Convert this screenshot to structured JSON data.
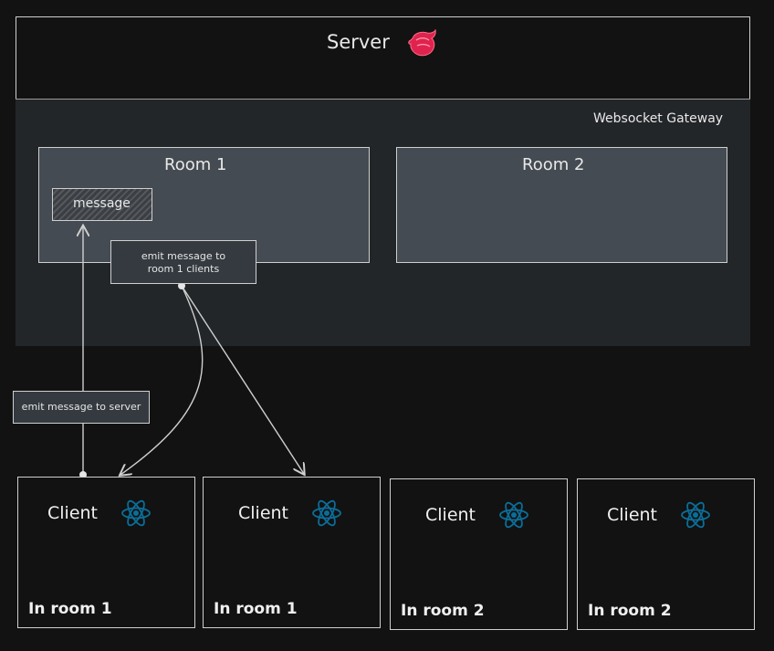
{
  "server": {
    "title": "Server",
    "logo_icon": "nestjs-cat-icon",
    "logo_color": "#e0234e"
  },
  "gateway": {
    "title": "Websocket Gateway"
  },
  "rooms": [
    {
      "title": "Room 1"
    },
    {
      "title": "Room 2"
    }
  ],
  "message": {
    "label": "message"
  },
  "notes": {
    "emit_to_clients": [
      "emit message to",
      "room 1 clients"
    ],
    "emit_to_server": "emit message to server"
  },
  "clients": [
    {
      "label": "Client",
      "room": "In room 1",
      "icon": "react-icon"
    },
    {
      "label": "Client",
      "room": "In room 1",
      "icon": "react-icon"
    },
    {
      "label": "Client",
      "room": "In room 2",
      "icon": "react-icon"
    },
    {
      "label": "Client",
      "room": "In room 2",
      "icon": "react-icon"
    }
  ],
  "colors": {
    "background": "#121212",
    "room_fill": "#454b52",
    "gateway_fill": "#232629",
    "react_blue": "#0b6e99"
  }
}
